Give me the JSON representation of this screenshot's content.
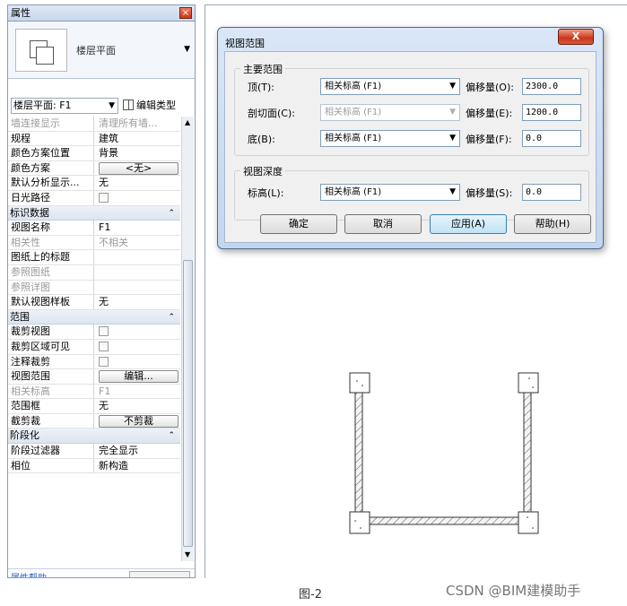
{
  "panel": {
    "title": "属性",
    "close_glyph": "×",
    "type_name": "楼层平面",
    "type_caret": "▼",
    "view_selector": "楼层平面: F1",
    "view_caret": "▼",
    "edit_type": "编辑类型",
    "footer_link": "属性帮助"
  },
  "rows": [
    {
      "k": "墙连接显示",
      "v": "清理所有墙...",
      "grey": true
    },
    {
      "k": "规程",
      "v": "建筑"
    },
    {
      "k": "颜色方案位置",
      "v": "背景"
    },
    {
      "k": "颜色方案",
      "button": "<无>"
    },
    {
      "k": "默认分析显示...",
      "v": "无"
    },
    {
      "k": "日光路径",
      "checkbox": true
    },
    {
      "group": "标识数据"
    },
    {
      "k": "视图名称",
      "v": "F1"
    },
    {
      "k": "相关性",
      "v": "不相关",
      "grey": true
    },
    {
      "k": "图纸上的标题",
      "v": ""
    },
    {
      "k": "参照图纸",
      "v": "",
      "grey": true
    },
    {
      "k": "参照详图",
      "v": "",
      "grey": true
    },
    {
      "k": "默认视图样板",
      "v": "无"
    },
    {
      "group": "范围"
    },
    {
      "k": "裁剪视图",
      "checkbox": true
    },
    {
      "k": "裁剪区域可见",
      "checkbox": true
    },
    {
      "k": "注释裁剪",
      "checkbox": true
    },
    {
      "k": "视图范围",
      "button": "编辑..."
    },
    {
      "k": "相关标高",
      "v": "F1",
      "grey": true
    },
    {
      "k": "范围框",
      "v": "无"
    },
    {
      "k": "截剪裁",
      "button": "不剪裁"
    },
    {
      "group": "阶段化"
    },
    {
      "k": "阶段过滤器",
      "v": "完全显示"
    },
    {
      "k": "相位",
      "v": "新构造"
    }
  ],
  "group_glyph": "⌃",
  "dialog": {
    "title": "视图范围",
    "close_glyph": "X",
    "primary_range_label": "主要范围",
    "top_label": "顶(T):",
    "top_level": "相关标高 (F1)",
    "top_offset_label": "偏移量(O):",
    "top_offset": "2300.0",
    "cut_label": "剖切面(C):",
    "cut_level": "相关标高 (F1)",
    "cut_offset_label": "偏移量(E):",
    "cut_offset": "1200.0",
    "bottom_label": "底(B):",
    "bottom_level": "相关标高 (F1)",
    "bottom_offset_label": "偏移量(F):",
    "bottom_offset": "0.0",
    "view_depth_label": "视图深度",
    "depth_label": "标高(L):",
    "depth_level": "相关标高 (F1)",
    "depth_offset_label": "偏移量(S):",
    "depth_offset": "0.0",
    "ok": "确定",
    "cancel": "取消",
    "apply": "应用(A)",
    "help": "帮助(H)",
    "combo_caret": "▼"
  },
  "caption": "图-2",
  "watermark": "CSDN @BIM建模助手"
}
